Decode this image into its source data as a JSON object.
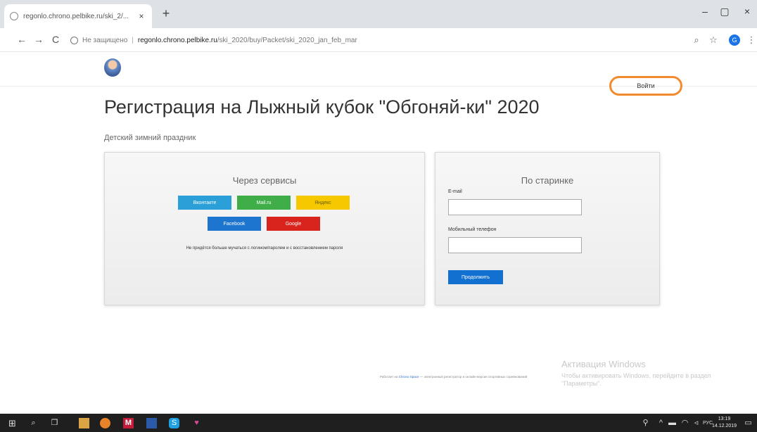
{
  "browser": {
    "tab_title": "regonlo.chrono.pelbike.ru/ski_2/...",
    "tab_close": "×",
    "new_tab": "+",
    "window_controls": {
      "minimize": "–",
      "maximize": "▢",
      "close": "×"
    },
    "nav": {
      "back": "←",
      "forward": "→",
      "reload": "C"
    },
    "security_label": "Не защищено",
    "url_host": "regonlo.chrono.pelbike.ru",
    "url_path": "/ski_2020/buy/Packet/ski_2020_jan_feb_mar",
    "zoom_icon": "search-icon",
    "bookmark_icon": "☆",
    "profile_initial": "G",
    "menu_icon": "⋮"
  },
  "header": {
    "login_label": "Войти"
  },
  "page": {
    "title": "Регистрация на Лыжный кубок \"Обгоняй-ки\" 2020",
    "subtitle": "Детский зимний праздник"
  },
  "services_panel": {
    "title": "Через сервисы",
    "buttons": {
      "vk": "Вконтакте",
      "mail": "Mail.ru",
      "yandex": "Яндекс",
      "facebook": "Facebook",
      "google": "Google"
    },
    "note": "Не придётся больше мучаться с логином/паролем и с восстановлением пароля"
  },
  "classic_panel": {
    "title": "По старинке",
    "email_label": "E-mail",
    "email_value": "",
    "phone_label": "Мобильный телефон",
    "phone_value": "",
    "submit_label": "Продолжить"
  },
  "footer": {
    "prefix": "Работает на",
    "link": "Chrono Space",
    "rest": " — электронный регистратор и онлайн-версия спортивных соревнований"
  },
  "windows_activation": {
    "title": "Активация Windows",
    "text": "Чтобы активировать Windows, перейдите в раздел \"Параметры\"."
  },
  "taskbar": {
    "lang": "РУС",
    "time": "13:19",
    "date": "14.12.2019"
  },
  "colors": {
    "accent": "#1170d0",
    "highlight_ring": "#f28a2e",
    "vk": "#2ba0d8",
    "mail": "#3fae49",
    "yandex": "#f5c800",
    "facebook": "#1e75cf",
    "google": "#d9231d"
  }
}
